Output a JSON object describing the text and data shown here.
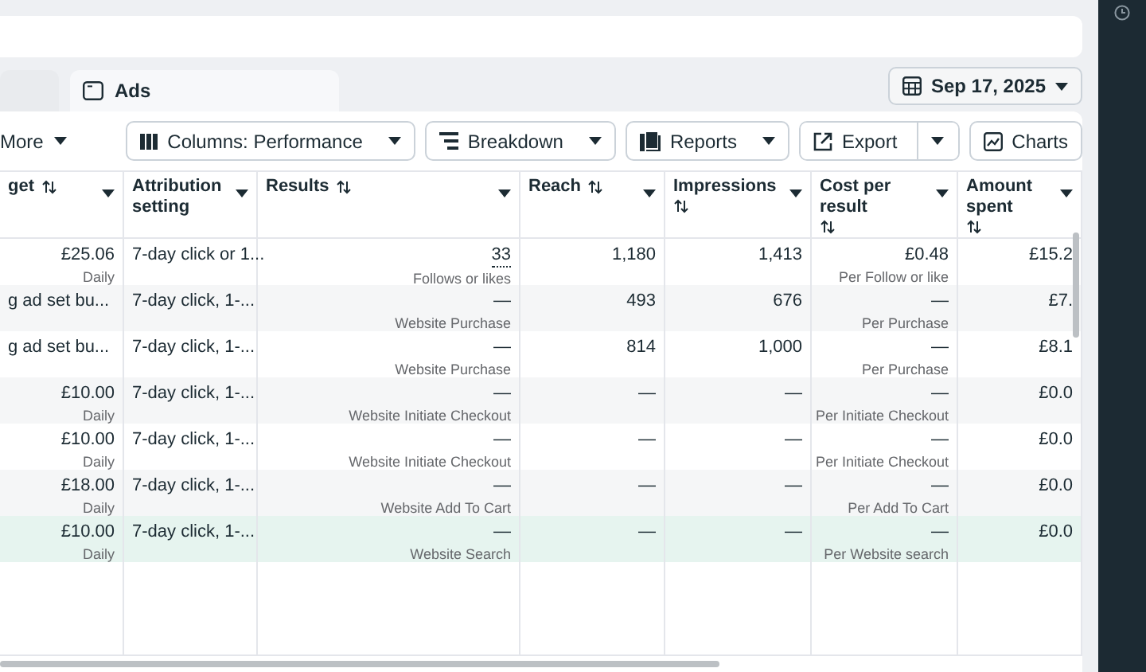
{
  "tabs": [
    {
      "label": "Ads",
      "selected": true
    }
  ],
  "date_button": {
    "label": "Sep 17, 2025"
  },
  "toolbar": {
    "more": "More",
    "buttons": [
      {
        "kind": "dropdown",
        "label": "Columns: Performance"
      },
      {
        "kind": "dropdown",
        "label": "Breakdown"
      },
      {
        "kind": "dropdown",
        "label": "Reports"
      },
      {
        "kind": "split",
        "label": "Export"
      },
      {
        "kind": "plain",
        "label": "Charts"
      }
    ]
  },
  "table": {
    "columns": [
      {
        "label": "get",
        "kind": "number",
        "sortable": true
      },
      {
        "label": "Attribution setting",
        "kind": "text",
        "sortable": false
      },
      {
        "label": "Results",
        "kind": "number",
        "sortable": true
      },
      {
        "label": "Reach",
        "kind": "number",
        "sortable": true
      },
      {
        "label": "Impressions",
        "kind": "number",
        "sortable": true
      },
      {
        "label": "Cost per result",
        "kind": "number",
        "sortable": true
      },
      {
        "label": "Amount spent",
        "kind": "number",
        "sortable": true
      }
    ],
    "rows": [
      {
        "highlighted": false,
        "cells": [
          {
            "text": "£25.06",
            "sub": "Daily"
          },
          {
            "text": "7-day click or 1..."
          },
          {
            "text": "33",
            "sub": "Follows or likes",
            "link": true
          },
          {
            "text": "1,180"
          },
          {
            "text": "1,413"
          },
          {
            "text": "£0.48",
            "sub": "Per Follow or like"
          },
          {
            "text": "£15.2"
          }
        ]
      },
      {
        "highlighted": false,
        "cells": [
          {
            "kind": "text",
            "text": "g ad set bu..."
          },
          {
            "text": "7-day click, 1-..."
          },
          {
            "text": "—",
            "sub": "Website Purchase"
          },
          {
            "text": "493"
          },
          {
            "text": "676"
          },
          {
            "text": "—",
            "sub": "Per Purchase"
          },
          {
            "text": "£7."
          }
        ]
      },
      {
        "highlighted": false,
        "cells": [
          {
            "kind": "text",
            "text": "g ad set bu..."
          },
          {
            "text": "7-day click, 1-..."
          },
          {
            "text": "—",
            "sub": "Website Purchase"
          },
          {
            "text": "814"
          },
          {
            "text": "1,000"
          },
          {
            "text": "—",
            "sub": "Per Purchase"
          },
          {
            "text": "£8.1"
          }
        ]
      },
      {
        "highlighted": false,
        "cells": [
          {
            "kind": "number",
            "text": "£10.00",
            "sub": "Daily"
          },
          {
            "text": "7-day click, 1-..."
          },
          {
            "text": "—",
            "sub": "Website Initiate Checkout"
          },
          {
            "text": "—"
          },
          {
            "text": "—"
          },
          {
            "text": "—",
            "sub": "Per Initiate Checkout"
          },
          {
            "text": "£0.0"
          }
        ]
      },
      {
        "highlighted": false,
        "cells": [
          {
            "kind": "number",
            "text": "£10.00",
            "sub": "Daily"
          },
          {
            "text": "7-day click, 1-..."
          },
          {
            "text": "—",
            "sub": "Website Initiate Checkout"
          },
          {
            "text": "—"
          },
          {
            "text": "—"
          },
          {
            "text": "—",
            "sub": "Per Initiate Checkout"
          },
          {
            "text": "£0.0"
          }
        ]
      },
      {
        "highlighted": false,
        "cells": [
          {
            "kind": "number",
            "text": "£18.00",
            "sub": "Daily"
          },
          {
            "text": "7-day click, 1-..."
          },
          {
            "text": "—",
            "sub": "Website Add To Cart"
          },
          {
            "text": "—"
          },
          {
            "text": "—"
          },
          {
            "text": "—",
            "sub": "Per Add To Cart"
          },
          {
            "text": "£0.0"
          }
        ]
      },
      {
        "highlighted": true,
        "cells": [
          {
            "kind": "number",
            "text": "£10.00",
            "sub": "Daily"
          },
          {
            "text": "7-day click, 1-..."
          },
          {
            "text": "—",
            "sub": "Website Search"
          },
          {
            "text": "—"
          },
          {
            "text": "—"
          },
          {
            "text": "—",
            "sub": "Per Website search"
          },
          {
            "text": "£0.0"
          }
        ]
      }
    ]
  }
}
